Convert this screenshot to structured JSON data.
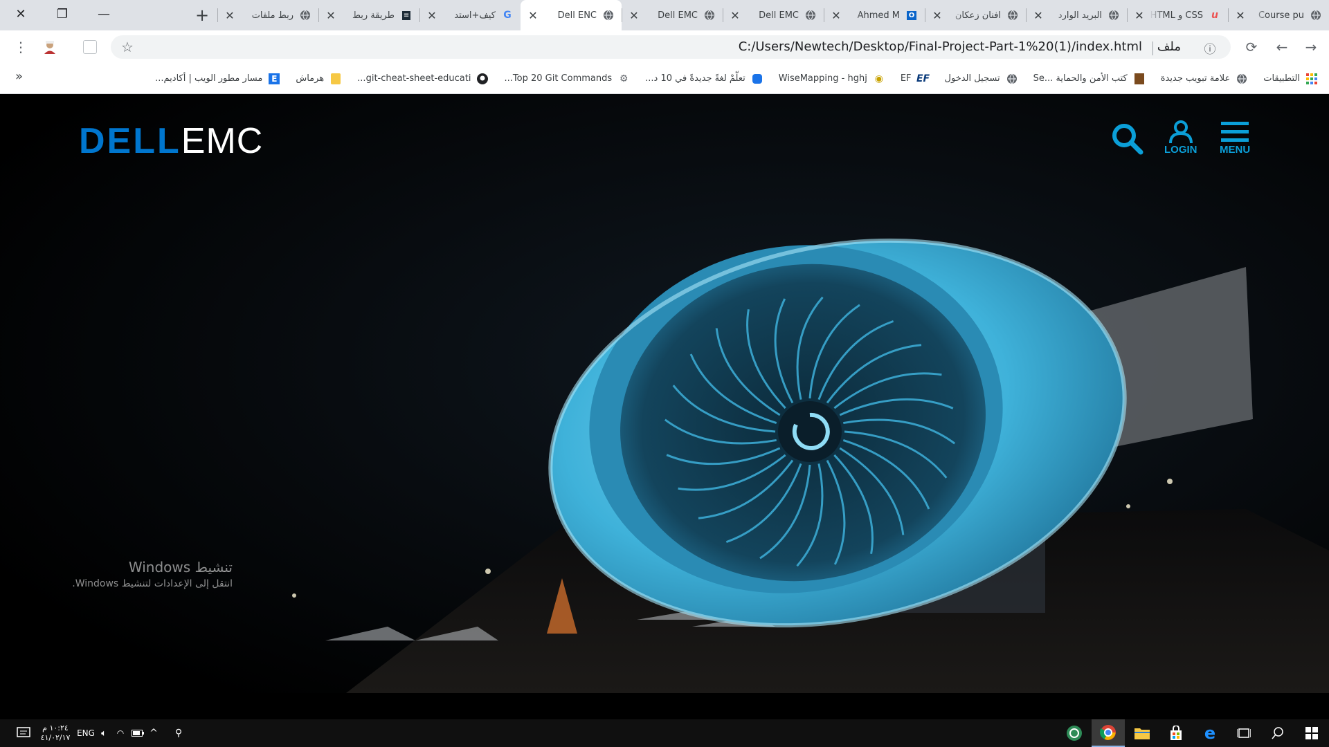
{
  "browser": {
    "tabs": [
      {
        "title": "Course pu",
        "icon": "globe-icon",
        "active": false
      },
      {
        "title": "CSS و HTML",
        "icon": "udemy-icon",
        "active": false
      },
      {
        "title": "البريد الوارد",
        "icon": "globe-icon",
        "active": false
      },
      {
        "title": "افنان زعكان",
        "icon": "globe-icon",
        "active": false
      },
      {
        "title": "Ahmed M",
        "icon": "outlook-icon",
        "active": false
      },
      {
        "title": "Dell EMC",
        "icon": "globe-icon",
        "active": false
      },
      {
        "title": "Dell EMC",
        "icon": "globe-icon",
        "active": false
      },
      {
        "title": "Dell ENC",
        "icon": "globe-icon",
        "active": true
      },
      {
        "title": "كيف+استد",
        "icon": "google-icon",
        "active": false
      },
      {
        "title": "طريقة ربط",
        "icon": "site-icon",
        "active": false
      },
      {
        "title": "ربط ملفات",
        "icon": "globe-icon",
        "active": false
      }
    ],
    "new_tab_label": "+",
    "address": {
      "scheme_label": "ملف",
      "url": "C:/Users/Newtech/Desktop/Final-Project-Part-1%20(1)/index.html"
    },
    "bookmarks": [
      {
        "label": "التطبيقات",
        "icon": "apps-grid-icon",
        "color": "#ea4335"
      },
      {
        "label": "علامة تبويب جديدة",
        "icon": "globe-icon",
        "color": "#5f6368"
      },
      {
        "label": "كتب الأمن والحماية ...Se",
        "icon": "book-icon",
        "color": "#7a4a1e"
      },
      {
        "label": "تسجيل الدخول",
        "icon": "globe-icon",
        "color": "#5f6368"
      },
      {
        "label": "EF",
        "icon": "ef-icon",
        "color": "#0a3a7a"
      },
      {
        "label": "WiseMapping - hghj",
        "icon": "mapping-icon",
        "color": "#c8a200"
      },
      {
        "label": "تعلّمْ لغةً جديدةً في 10 د...",
        "icon": "app-icon",
        "color": "#1a73e8"
      },
      {
        "label": "Top 20 Git Commands...",
        "icon": "git-icon",
        "color": "#5f6368"
      },
      {
        "label": "git-cheat-sheet-educati...",
        "icon": "github-icon",
        "color": "#202124"
      },
      {
        "label": "هرماش",
        "icon": "folder-icon",
        "color": "#f6c844"
      },
      {
        "label": "مسار مطور الويب | أكاديم...",
        "icon": "e-icon",
        "color": "#1a73e8"
      }
    ],
    "more_label": "»"
  },
  "page": {
    "logo": {
      "dell": "DELL",
      "emc": "EMC"
    },
    "nav": {
      "login": "LOGIN",
      "menu": "MENU"
    },
    "accent": "#0b9fd8"
  },
  "watermark": {
    "title": "تنشيط Windows",
    "subtitle": "انتقل إلى الإعدادات لتنشيط Windows."
  },
  "taskbar": {
    "language": "ENG",
    "time": "١٠:٢٤ م",
    "date": "٤١/٠٢/١٧"
  }
}
